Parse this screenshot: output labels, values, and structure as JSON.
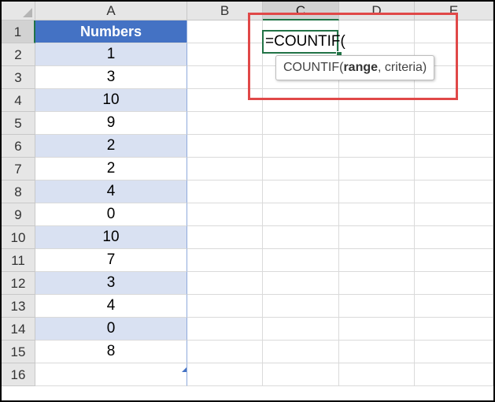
{
  "columns": [
    "A",
    "B",
    "C",
    "D",
    "E"
  ],
  "rows": [
    "1",
    "2",
    "3",
    "4",
    "5",
    "6",
    "7",
    "8",
    "9",
    "10",
    "11",
    "12",
    "13",
    "14",
    "15",
    "16"
  ],
  "table": {
    "header": "Numbers",
    "values": [
      "1",
      "3",
      "10",
      "9",
      "2",
      "2",
      "4",
      "0",
      "10",
      "7",
      "3",
      "4",
      "0",
      "8"
    ]
  },
  "formula": {
    "text": "=COUNTIF(",
    "tooltip_fn": "COUNTIF(",
    "tooltip_arg1": "range",
    "tooltip_rest": ", criteria)"
  },
  "colors": {
    "table_header": "#4472c4",
    "table_band": "#d9e1f2",
    "selection": "#217346",
    "highlight_box": "#e04848"
  }
}
